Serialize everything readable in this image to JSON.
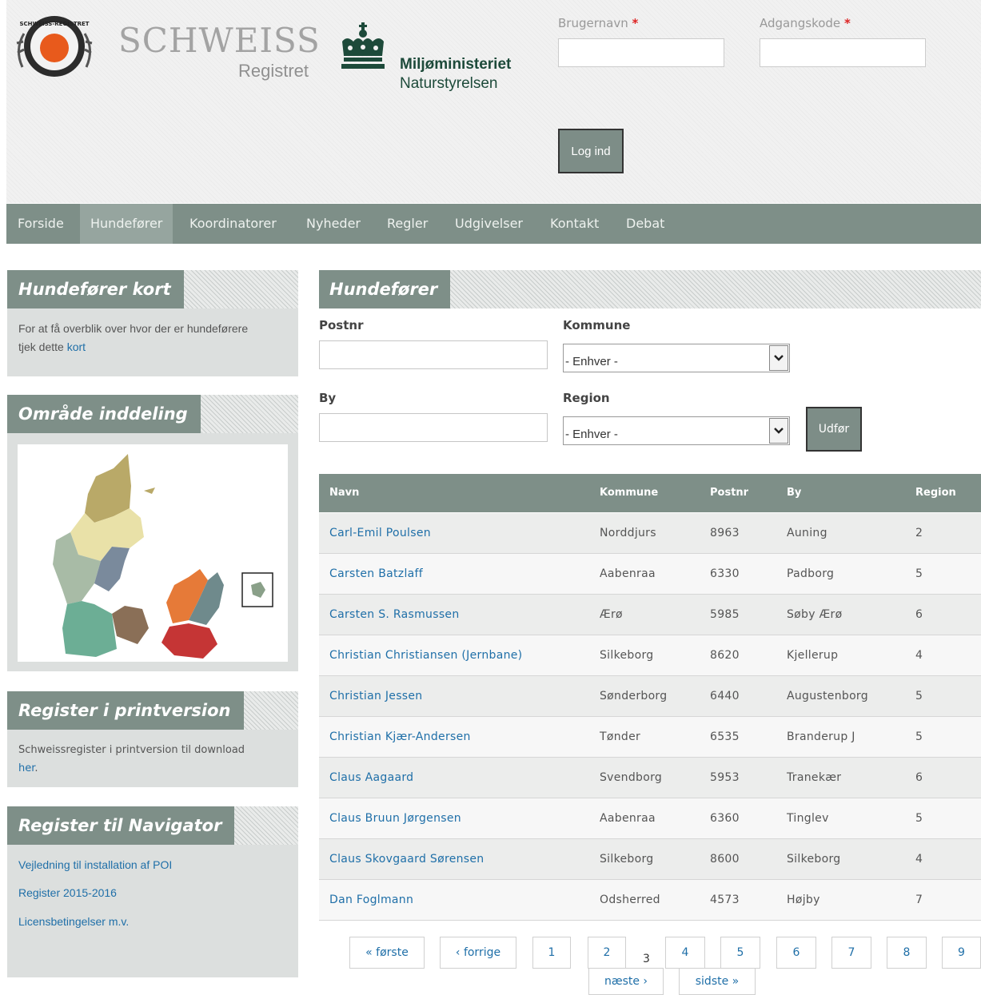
{
  "header": {
    "site_name": "SCHWEISS",
    "site_subname": "Registret",
    "seal_text": "SCHWEISS-REGISTRET",
    "ministry": "Miljøministeriet",
    "agency": "Naturstyrelsen",
    "username_label": "Brugernavn",
    "password_label": "Adgangskode",
    "required_mark": "*",
    "login_button": "Log ind"
  },
  "nav": {
    "items": [
      "Forside",
      "Hundefører",
      "Koordinatorer",
      "Nyheder",
      "Regler",
      "Udgivelser",
      "Kontakt",
      "Debat"
    ],
    "active": "Hundefører"
  },
  "sidebar": {
    "map_block": {
      "title": "Hundefører kort",
      "text": "For at få overblik over hvor der er hundeførere",
      "text2": "tjek dette",
      "link": "kort"
    },
    "region_block": {
      "title": "Område inddeling"
    },
    "print_block": {
      "title": "Register i printversion",
      "text": "Schweissregister i printversion til download",
      "link": "her",
      "period": "."
    },
    "navigator_block": {
      "title": "Register til Navigator",
      "links": [
        "Vejledning til installation af POI",
        "Register 2015-2016",
        "Licensbetingelser m.v."
      ]
    }
  },
  "main": {
    "title": "Hundefører",
    "filters": {
      "postnr_label": "Postnr",
      "kommune_label": "Kommune",
      "kommune_value": "- Enhver -",
      "by_label": "By",
      "region_label": "Region",
      "region_value": "- Enhver -",
      "submit": "Udfør"
    },
    "table": {
      "headers": [
        "Navn",
        "Kommune",
        "Postnr",
        "By",
        "Region"
      ],
      "rows": [
        [
          "Carl-Emil Poulsen",
          "Norddjurs",
          "8963",
          "Auning",
          "2"
        ],
        [
          "Carsten Batzlaff",
          "Aabenraa",
          "6330",
          "Padborg",
          "5"
        ],
        [
          "Carsten S. Rasmussen",
          "Ærø",
          "5985",
          "Søby Ærø",
          "6"
        ],
        [
          "Christian Christiansen (Jernbane)",
          "Silkeborg",
          "8620",
          "Kjellerup",
          "4"
        ],
        [
          "Christian Jessen",
          "Sønderborg",
          "6440",
          "Augustenborg",
          "5"
        ],
        [
          "Christian Kjær-Andersen",
          "Tønder",
          "6535",
          "Branderup J",
          "5"
        ],
        [
          "Claus Aagaard",
          "Svendborg",
          "5953",
          "Tranekær",
          "6"
        ],
        [
          "Claus Bruun Jørgensen",
          "Aabenraa",
          "6360",
          "Tinglev",
          "5"
        ],
        [
          "Claus Skovgaard Sørensen",
          "Silkeborg",
          "8600",
          "Silkeborg",
          "4"
        ],
        [
          "Dan Foglmann",
          "Odsherred",
          "4573",
          "Højby",
          "7"
        ]
      ]
    },
    "pager": {
      "first": "« første",
      "prev": "‹ forrige",
      "pages": [
        "1",
        "2",
        "3",
        "4",
        "5",
        "6",
        "7",
        "8",
        "9"
      ],
      "current": "3",
      "next": "næste ›",
      "last": "sidste »"
    }
  },
  "colors": {
    "nav_bg": "#7e8f88",
    "link": "#1f6fa8",
    "ministry_text": "#1d4a3a"
  }
}
